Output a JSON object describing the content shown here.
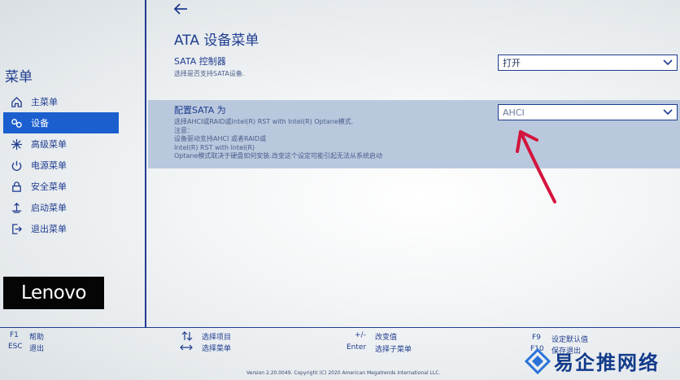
{
  "sidebar": {
    "title": "菜单",
    "items": [
      {
        "label": "主菜单",
        "icon": "home-icon",
        "active": false
      },
      {
        "label": "设备",
        "icon": "devices-icon",
        "active": true
      },
      {
        "label": "高级菜单",
        "icon": "advanced-icon",
        "active": false
      },
      {
        "label": "电源菜单",
        "icon": "power-icon",
        "active": false
      },
      {
        "label": "安全菜单",
        "icon": "lock-icon",
        "active": false
      },
      {
        "label": "启动菜单",
        "icon": "boot-icon",
        "active": false
      },
      {
        "label": "退出菜单",
        "icon": "exit-icon",
        "active": false
      }
    ],
    "logo": "Lenovo"
  },
  "main": {
    "title": "ATA 设备菜单",
    "settings": [
      {
        "label": "SATA 控制器",
        "help": [
          "选择是否支持SATA设备."
        ],
        "value": "打开"
      },
      {
        "label": "配置SATA 为",
        "help": [
          "选择AHCI或RAID或Intel(R) RST with Intel(R) Optane模式.",
          "注意：",
          "设备驱动支持AHCI 或者RAID或",
          "Intel(R) RST with Intel(R)",
          "Optane模式取决于硬盘如何安装.改变这个设定可能引起无法从系统启动"
        ],
        "value": "AHCI"
      }
    ]
  },
  "footer": {
    "f1_key": "F1",
    "f1_label": "帮助",
    "esc_key": "ESC",
    "esc_label": "退出",
    "updown_label": "选择项目",
    "leftright_label": "选择菜单",
    "plusminus_key": "+/-",
    "plusminus_label": "改变值",
    "enter_key": "Enter",
    "enter_label": "选择子菜单",
    "f9_key": "F9",
    "f9_label": "设定默认值",
    "f10_key": "F10",
    "f10_label": "保存退出",
    "copyright": "Version 2.20.0049. Copyright (C) 2020 American Megatrends International LLC."
  },
  "watermark": "易企推网络",
  "colors": {
    "accent": "#1f3c8f",
    "active": "#1b5fcf",
    "highlight_row": "#b9c8dd",
    "annotation": "#d4143c"
  }
}
